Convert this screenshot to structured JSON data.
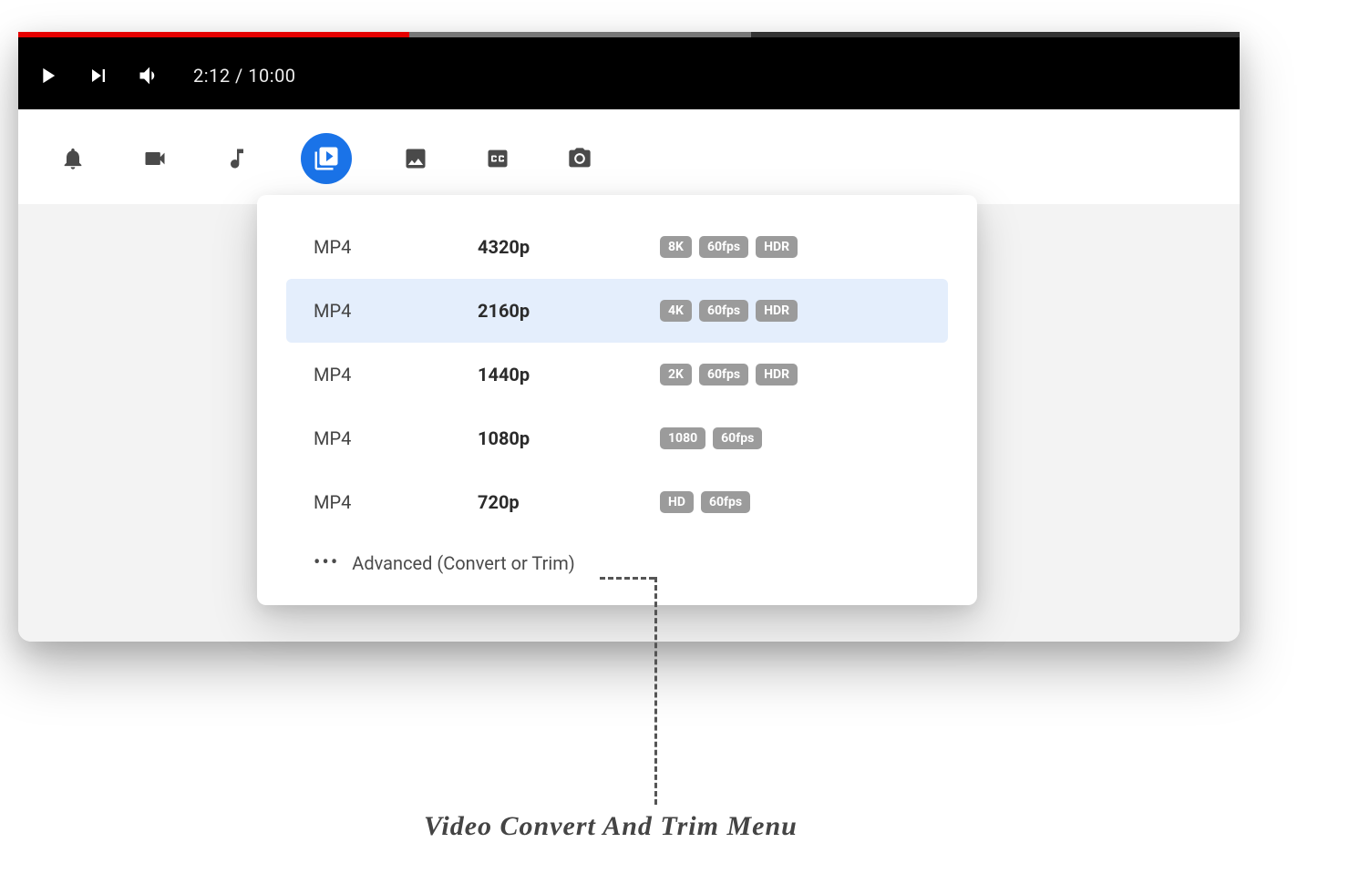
{
  "player": {
    "time_display": "2:12 / 10:00",
    "progress_played_pct": 32,
    "progress_buffered_pct": 60
  },
  "toolbar": {
    "icons": [
      "bell",
      "video-camera",
      "music-note",
      "video-library",
      "image",
      "cc",
      "camera"
    ],
    "active_index": 3
  },
  "dropdown": {
    "options": [
      {
        "format": "MP4",
        "resolution": "4320p",
        "badges": [
          "8K",
          "60fps",
          "HDR"
        ],
        "highlight": false
      },
      {
        "format": "MP4",
        "resolution": "2160p",
        "badges": [
          "4K",
          "60fps",
          "HDR"
        ],
        "highlight": true
      },
      {
        "format": "MP4",
        "resolution": "1440p",
        "badges": [
          "2K",
          "60fps",
          "HDR"
        ],
        "highlight": false
      },
      {
        "format": "MP4",
        "resolution": "1080p",
        "badges": [
          "1080",
          "60fps"
        ],
        "highlight": false
      },
      {
        "format": "MP4",
        "resolution": "720p",
        "badges": [
          "HD",
          "60fps"
        ],
        "highlight": false
      }
    ],
    "advanced_label": "Advanced (Convert or Trim)"
  },
  "annotation": {
    "label": "Video Convert And Trim Menu"
  }
}
